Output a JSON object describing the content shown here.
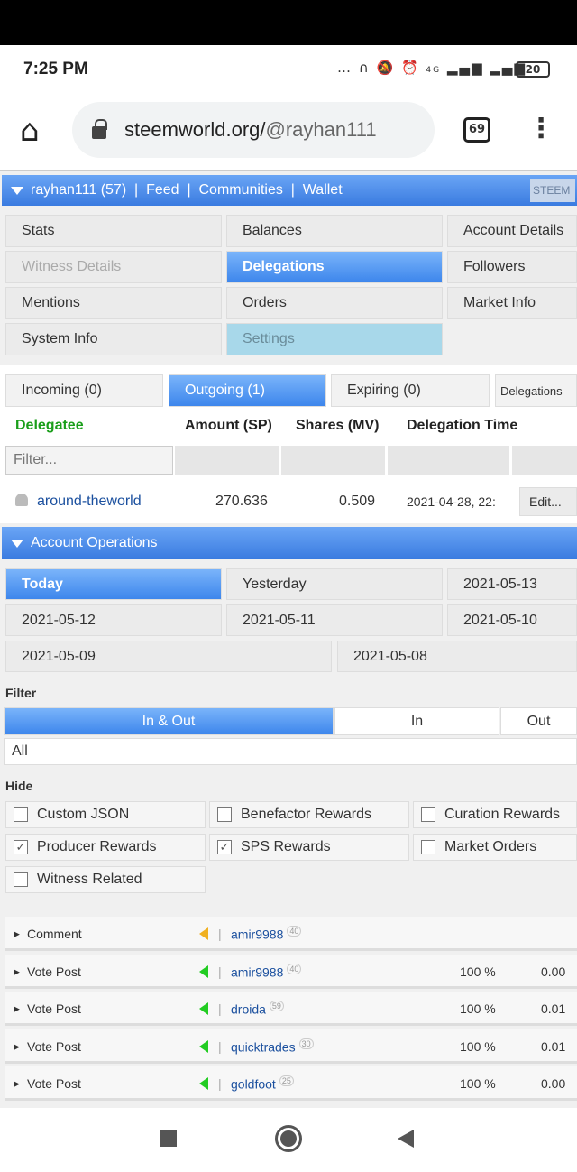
{
  "status": {
    "time": "7:25 PM",
    "battery": "20",
    "network": "4G"
  },
  "browser": {
    "url_host": "steemworld.org/",
    "url_path": "@rayhan111",
    "tab_count": "69"
  },
  "header": {
    "user": "rayhan111 (57)",
    "links": [
      "Feed",
      "Communities",
      "Wallet"
    ],
    "steem_button": "STEEM"
  },
  "menu": [
    [
      "Stats",
      "Balances",
      "Account Details"
    ],
    [
      "Witness Details",
      "Delegations",
      "Followers"
    ],
    [
      "Mentions",
      "Orders",
      "Market Info"
    ],
    [
      "System Info",
      "Settings"
    ]
  ],
  "delegation_tabs": [
    "Incoming (0)",
    "Outgoing (1)",
    "Expiring (0)",
    "Delegations"
  ],
  "table": {
    "headers": [
      "Delegatee",
      "Amount (SP)",
      "Shares (MV)",
      "Delegation Time"
    ],
    "filter_placeholder": "Filter...",
    "rows": [
      {
        "delegatee": "around-theworld",
        "amount": "270.636",
        "shares": "0.509",
        "time": "2021-04-28, 22:",
        "action": "Edit..."
      }
    ]
  },
  "operations": {
    "title": "Account Operations",
    "dates": [
      "Today",
      "Yesterday",
      "2021-05-13",
      "2021-05-12",
      "2021-05-11",
      "2021-05-10",
      "2021-05-09",
      "2021-05-08"
    ],
    "filter_label": "Filter",
    "filter_tabs": [
      "In & Out",
      "In",
      "Out"
    ],
    "filter_select": "All",
    "hide_label": "Hide",
    "hide_options": [
      {
        "label": "Custom JSON",
        "checked": false
      },
      {
        "label": "Benefactor Rewards",
        "checked": false
      },
      {
        "label": "Curation Rewards",
        "checked": false
      },
      {
        "label": "Producer Rewards",
        "checked": true
      },
      {
        "label": "SPS Rewards",
        "checked": true
      },
      {
        "label": "Market Orders",
        "checked": false
      },
      {
        "label": "Witness Related",
        "checked": false
      }
    ],
    "rows": [
      {
        "type": "Comment",
        "user": "amir9988",
        "rep": "40",
        "percent": "",
        "value": "",
        "color": "#f0b020"
      },
      {
        "type": "Vote Post",
        "user": "amir9988",
        "rep": "40",
        "percent": "100 %",
        "value": "0.00",
        "color": "#22cc22"
      },
      {
        "type": "Vote Post",
        "user": "droida",
        "rep": "59",
        "percent": "100 %",
        "value": "0.01",
        "color": "#22cc22"
      },
      {
        "type": "Vote Post",
        "user": "quicktrades",
        "rep": "30",
        "percent": "100 %",
        "value": "0.01",
        "color": "#22cc22"
      },
      {
        "type": "Vote Post",
        "user": "goldfoot",
        "rep": "25",
        "percent": "100 %",
        "value": "0.00",
        "color": "#22cc22"
      }
    ]
  }
}
